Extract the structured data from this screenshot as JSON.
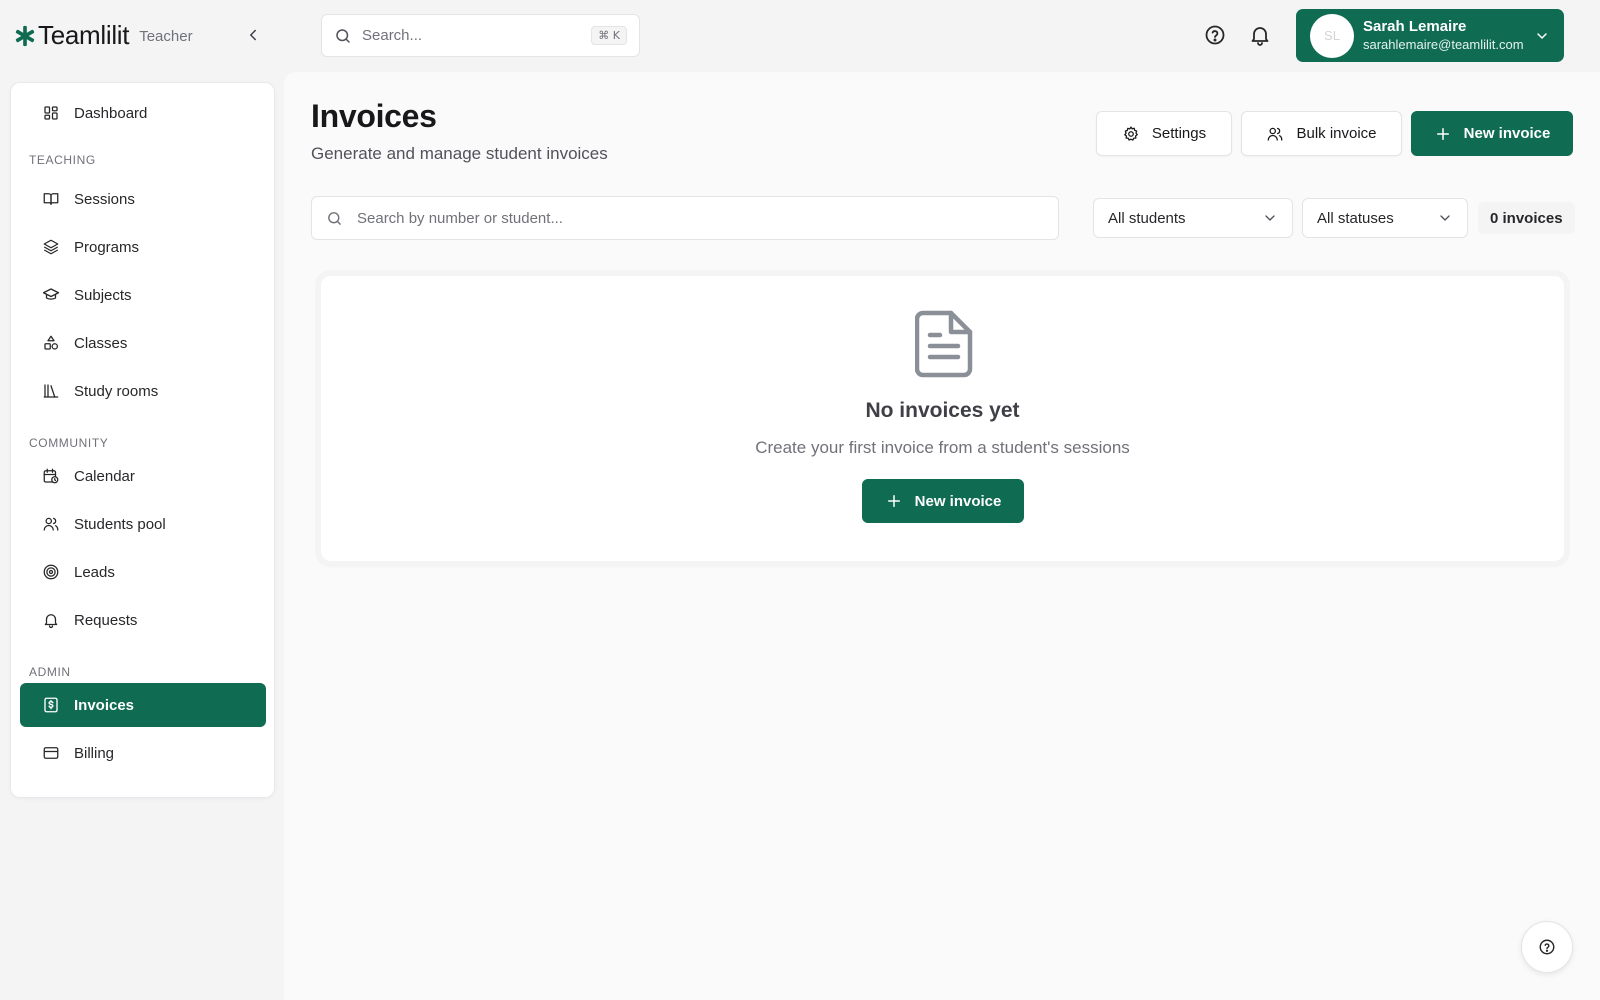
{
  "app": {
    "brand": "Teamlilit",
    "role": "Teacher"
  },
  "header": {
    "search_placeholder": "Search...",
    "search_shortcut": "⌘ K",
    "user": {
      "initials": "SL",
      "name": "Sarah Lemaire",
      "email": "sarahlemaire@teamlilit.com"
    }
  },
  "sidebar": {
    "dashboard": "Dashboard",
    "sections": {
      "teaching": "TEACHING",
      "community": "COMMUNITY",
      "admin": "ADMIN"
    },
    "teaching": [
      "Sessions",
      "Programs",
      "Subjects",
      "Classes",
      "Study rooms"
    ],
    "community": [
      "Calendar",
      "Students pool",
      "Leads",
      "Requests"
    ],
    "admin": [
      "Invoices",
      "Billing"
    ],
    "active": "Invoices"
  },
  "page": {
    "title": "Invoices",
    "subtitle": "Generate and manage student invoices",
    "buttons": {
      "settings": "Settings",
      "bulk": "Bulk invoice",
      "new": "New invoice"
    },
    "filters": {
      "search_placeholder": "Search by number or student...",
      "students": "All students",
      "statuses": "All statuses",
      "count": "0 invoices"
    },
    "empty": {
      "title": "No invoices yet",
      "text": "Create your first invoice from a student's sessions",
      "button": "New invoice"
    }
  },
  "colors": {
    "brand": "#0f6b52",
    "background": "#f4f4f5",
    "surface": "#ffffff"
  },
  "icons": {
    "logo": "asterisk-logo-icon",
    "empty_state": "document-icon"
  }
}
